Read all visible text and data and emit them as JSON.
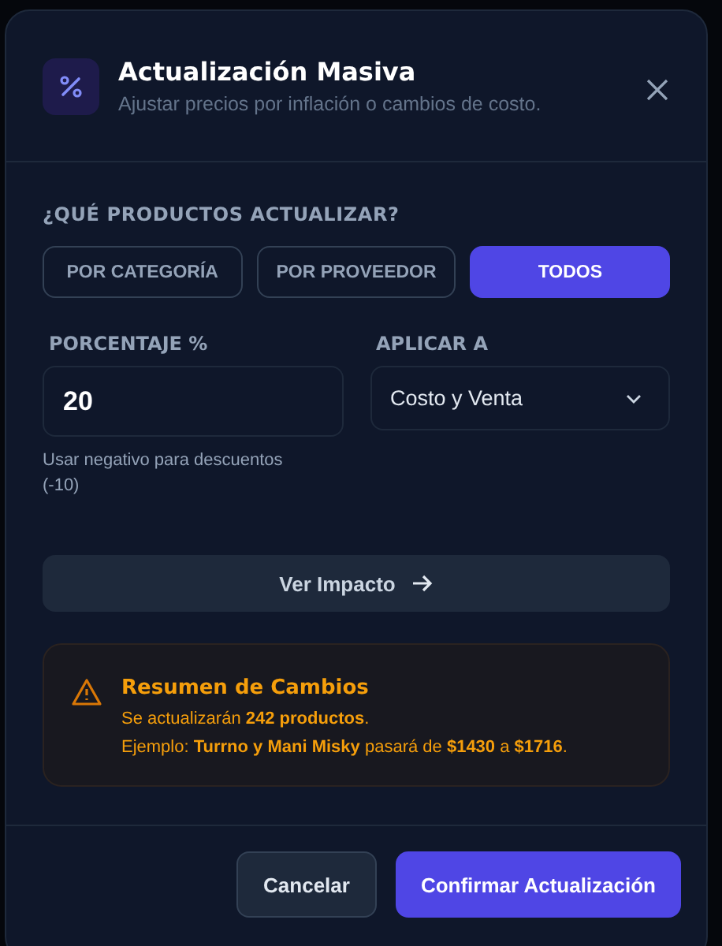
{
  "dialog": {
    "title": "Actualización Masiva",
    "subtitle": "Ajustar precios por inflación o cambios de costo."
  },
  "scope": {
    "label": "¿QUÉ PRODUCTOS ACTUALIZAR?",
    "options": [
      {
        "label": "POR CATEGORÍA",
        "selected": false
      },
      {
        "label": "POR PROVEEDOR",
        "selected": false
      },
      {
        "label": "TODOS",
        "selected": true
      }
    ]
  },
  "percentage": {
    "label": "PORCENTAJE %",
    "value": "20",
    "help": "Usar negativo para descuentos (-10)"
  },
  "apply_to": {
    "label": "APLICAR A",
    "value": "Costo y Venta"
  },
  "preview_button": "Ver Impacto",
  "summary": {
    "title": "Resumen de Cambios",
    "lines": [
      "Se actualizarán **242 productos**.",
      "Ejemplo: **Turrno y Mani Misky** pasará de **$1430** a **$1716**."
    ]
  },
  "buttons": {
    "cancel": "Cancelar",
    "confirm": "Confirmar Actualización"
  }
}
